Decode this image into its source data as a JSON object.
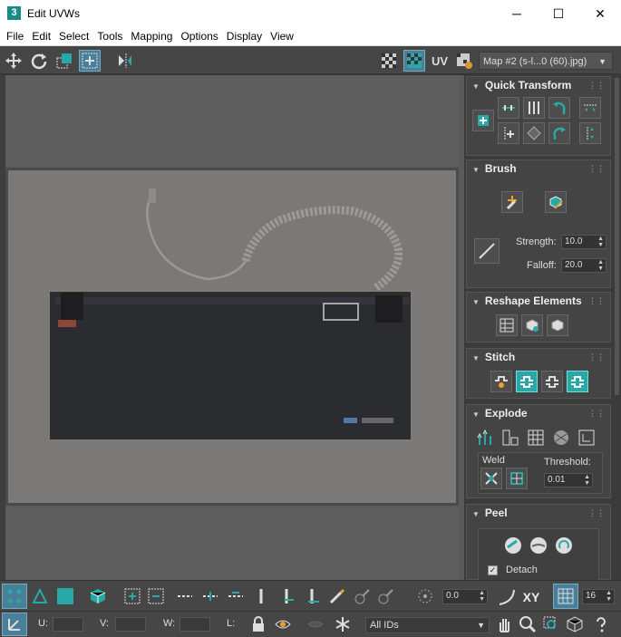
{
  "window": {
    "app_icon": "3",
    "title": "Edit UVWs",
    "minimize": "─",
    "maximize": "☐",
    "close": "✕"
  },
  "menu": [
    "File",
    "Edit",
    "Select",
    "Tools",
    "Mapping",
    "Options",
    "Display",
    "View"
  ],
  "toolbar": {
    "uv_label": "UV",
    "map_select": "Map #2 (s-l...0 (60).jpg)"
  },
  "viewport": {
    "photo_label": "keyboard-back-photo"
  },
  "rollouts": {
    "quick_transform": "Quick Transform",
    "brush": "Brush",
    "strength_label": "Strength:",
    "strength_value": "10.0",
    "falloff_label": "Falloff:",
    "falloff_value": "20.0",
    "reshape": "Reshape Elements",
    "stitch": "Stitch",
    "explode": "Explode",
    "weld_label": "Weld",
    "threshold_label": "Threshold:",
    "threshold_value": "0.01",
    "peel": "Peel",
    "detach_label": "Detach"
  },
  "bottom": {
    "rotate_value": "0.0",
    "xy_label": "XY",
    "snap_value": "16",
    "u_label": "U:",
    "v_label": "V:",
    "w_label": "W:",
    "l_label": "L:",
    "ids_select": "All IDs"
  },
  "colors": {
    "accent": "#2aa8a8",
    "panel": "#444444",
    "viewport": "#5a5a5a"
  }
}
